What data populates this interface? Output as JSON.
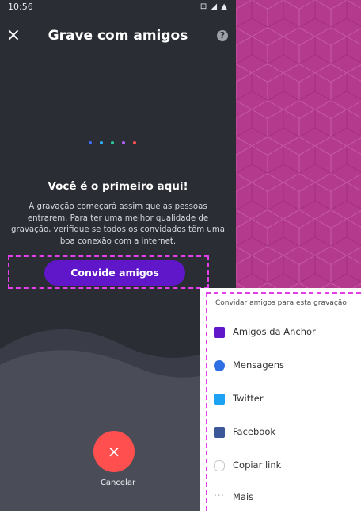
{
  "statusbar": {
    "time": "10:56",
    "right_icons": "⊡ ◢ ▲"
  },
  "header": {
    "close_icon": "×",
    "title": "Grave com amigos",
    "help_icon": "?"
  },
  "colors": {
    "accent": "#5f17c9",
    "danger": "#ff4f4f",
    "highlight": "#e23fe6",
    "dot_colors": [
      "#3a6cff",
      "#30b1ff",
      "#29c7a1",
      "#b060ff",
      "#ff4f4f"
    ]
  },
  "main": {
    "heading": "Você é o primeiro aqui!",
    "description": "A gravação começará assim que as pessoas entrarem. Para ter uma melhor qualidade de gravação, verifique se todos os convidados têm uma boa conexão com a internet.",
    "invite_button": "Convide amigos"
  },
  "cancel": {
    "icon": "×",
    "label": "Cancelar"
  },
  "share_sheet": {
    "title": "Convidar amigos para esta gravação",
    "items": [
      {
        "label": "Amigos da Anchor",
        "icon": "anchor-icon",
        "color": "#5f17c9"
      },
      {
        "label": "Mensagens",
        "icon": "messages-icon",
        "color": "#2f6fe4"
      },
      {
        "label": "Twitter",
        "icon": "twitter-icon",
        "color": "#1da1f2"
      },
      {
        "label": "Facebook",
        "icon": "facebook-icon",
        "color": "#3b5998"
      },
      {
        "label": "Copiar link",
        "icon": "link-icon",
        "color": "#c8c8c8"
      },
      {
        "label": "Mais",
        "icon": "more-icon",
        "color": "#c8c8c8"
      }
    ]
  }
}
